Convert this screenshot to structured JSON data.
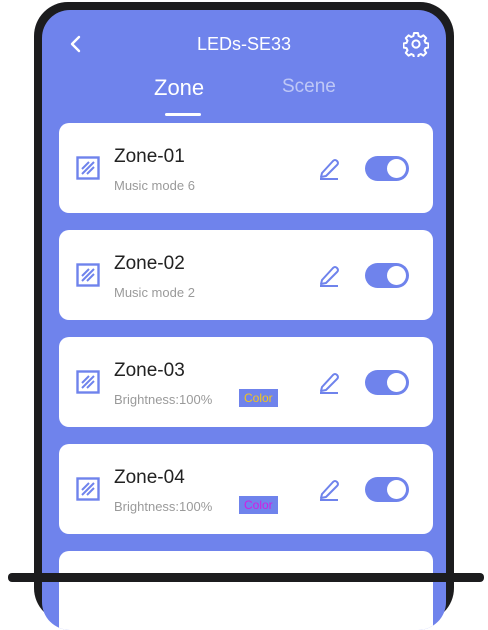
{
  "header": {
    "title": "LEDs-SE33",
    "back_icon": "chevron-left-icon",
    "settings_icon": "gear-icon"
  },
  "tabs": [
    {
      "label": "Zone",
      "active": true
    },
    {
      "label": "Scene",
      "active": false
    }
  ],
  "zones": [
    {
      "name": "Zone-01",
      "subtitle": "Music mode 6",
      "enabled": true
    },
    {
      "name": "Zone-02",
      "subtitle": "Music mode 2",
      "enabled": true
    },
    {
      "name": "Zone-03",
      "subtitle": "Brightness:100%",
      "color_label": "Color",
      "color_text": "#f5c518",
      "enabled": true
    },
    {
      "name": "Zone-04",
      "subtitle": "Brightness:100%",
      "color_label": "Color",
      "color_text": "#d21ee0",
      "enabled": true
    }
  ],
  "colors": {
    "accent": "#6f83ec",
    "card": "#ffffff",
    "phone_frame": "#1c1c1e"
  }
}
